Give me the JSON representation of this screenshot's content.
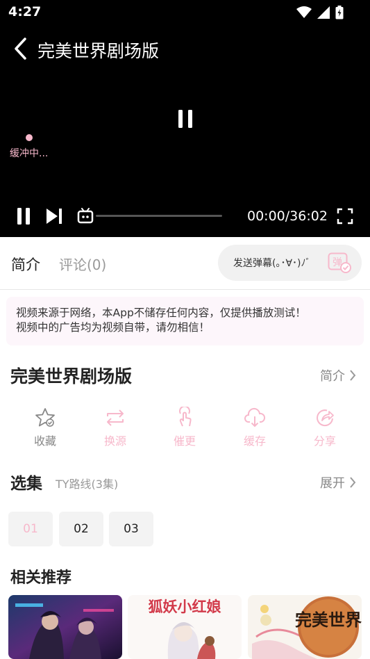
{
  "status_bar": {
    "time": "4:27"
  },
  "player": {
    "title": "完美世界剧场版",
    "buffering_text": "缓冲中...",
    "time_readout": "00:00/36:02",
    "progress": 0,
    "accent_color": "#f7b8cb"
  },
  "tabs": {
    "intro": "简介",
    "comments": "评论(0)"
  },
  "danmaku": {
    "placeholder": "发送弹幕(｡･∀･)ﾉﾞ",
    "button": "弹"
  },
  "notice": {
    "line1": "视频来源于网络，本App不储存任何内容，仅提供播放测试！",
    "line2": "视频中的广告均为视频自带，请勿相信！"
  },
  "detail": {
    "title": "完美世界剧场版",
    "intro_link": "简介"
  },
  "actions": [
    {
      "label": "收藏",
      "icon": "star-icon",
      "color": "#888888"
    },
    {
      "label": "换源",
      "icon": "swap-icon",
      "color": "#f7b8cb"
    },
    {
      "label": "催更",
      "icon": "tap-icon",
      "color": "#f7b8cb"
    },
    {
      "label": "缓存",
      "icon": "download-cloud-icon",
      "color": "#f7b8cb"
    },
    {
      "label": "分享",
      "icon": "share-icon",
      "color": "#f7b8cb"
    }
  ],
  "episodes": {
    "title": "选集",
    "route": "TY路线(3集)",
    "expand": "展开",
    "items": [
      "01",
      "02",
      "03"
    ],
    "selected": "01"
  },
  "recommendations": {
    "title": "相关推荐",
    "items": [
      {
        "art_text": ""
      },
      {
        "art_text": "狐妖小红娘"
      },
      {
        "art_text": "完美世界"
      }
    ]
  }
}
